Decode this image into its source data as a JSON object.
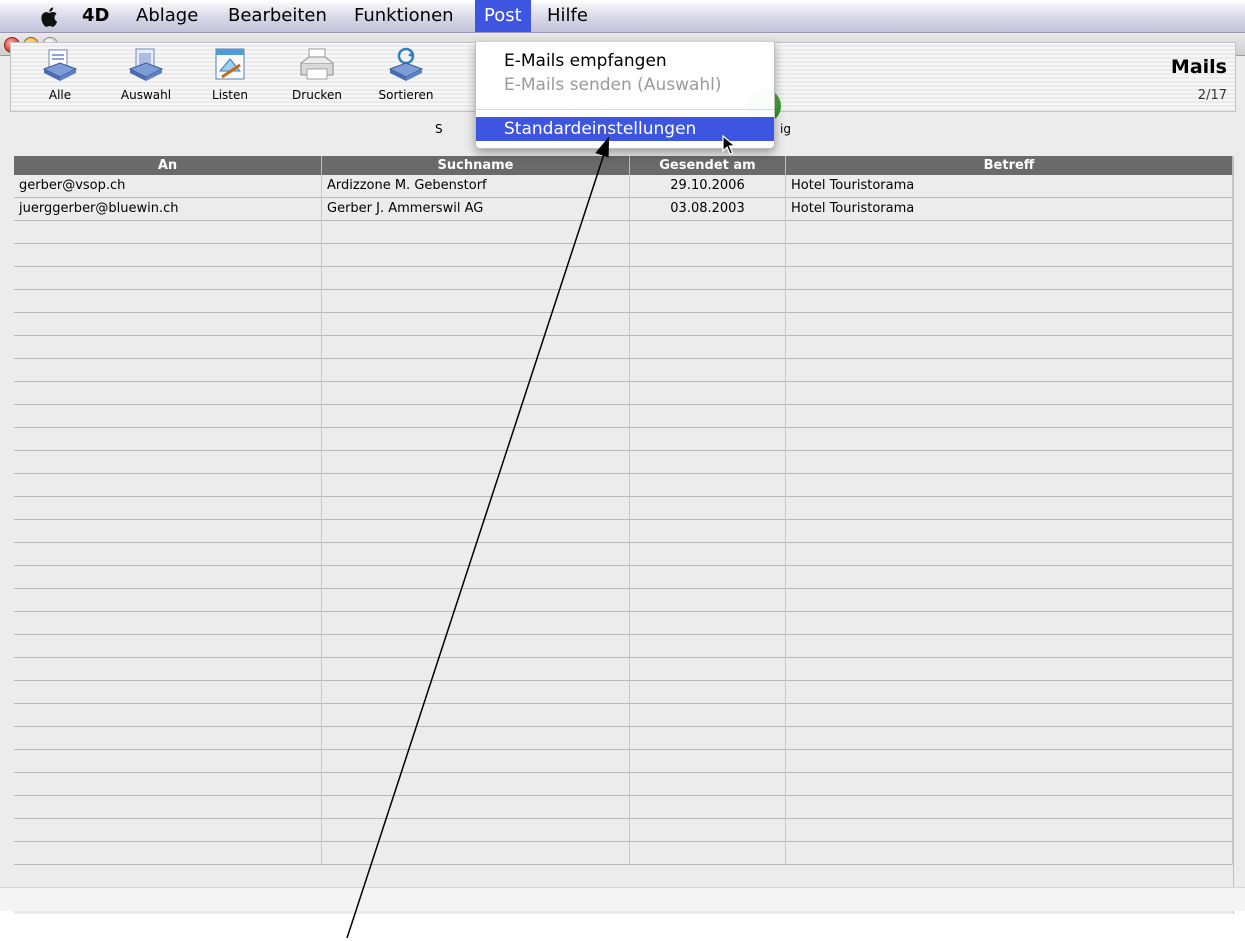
{
  "menubar": {
    "app_name": "4D",
    "items": [
      "Ablage",
      "Bearbeiten",
      "Funktionen",
      "Post",
      "Hilfe"
    ],
    "active": "Post"
  },
  "toolbar": {
    "buttons": [
      "Alle",
      "Auswahl",
      "Listen",
      "Drucken",
      "Sortieren"
    ],
    "partial_left": "S",
    "partial_right": "ig",
    "title": "Mails",
    "count": "2/17"
  },
  "post_menu": {
    "items": [
      {
        "label": "E-Mails empfangen",
        "enabled": true
      },
      {
        "label": "E-Mails senden (Auswahl)",
        "enabled": false
      },
      {
        "label": "Standardeinstellungen",
        "enabled": true,
        "highlighted": true
      }
    ]
  },
  "table": {
    "columns": [
      "An",
      "Suchname",
      "Gesendet am",
      "Betreff"
    ],
    "rows": [
      [
        "gerber@vsop.ch",
        "Ardizzone M. Gebenstorf",
        "29.10.2006",
        "Hotel Touristorama"
      ],
      [
        "juerggerber@bluewin.ch",
        "Gerber J. Ammerswil AG",
        "03.08.2003",
        "Hotel Touristorama"
      ]
    ]
  },
  "colors": {
    "menu_highlight": "#3d55e0",
    "header_bg": "#6a6a6a"
  }
}
